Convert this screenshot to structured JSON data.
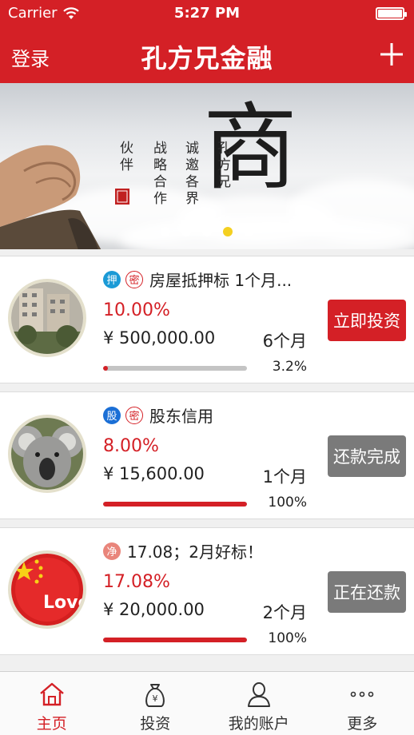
{
  "status_bar": {
    "carrier": "Carrier",
    "time": "5:27 PM"
  },
  "nav": {
    "login": "登录",
    "title": "孔方兄金融",
    "add_icon": "plus-icon"
  },
  "banner": {
    "big_char": "商",
    "col1": "孔方兄",
    "col2": "诚邀各界",
    "col3": "战略合作",
    "col4": "伙伴",
    "dot_count": 5,
    "active_dot": 3
  },
  "loans": [
    {
      "tags": [
        "押",
        "密"
      ],
      "title": "房屋抵押标 1个月...",
      "rate": "10.00%",
      "amount": "¥ 500,000.00",
      "term": "6个月",
      "progress": 0.032,
      "progress_text": "3.2%",
      "action": "立即投资",
      "action_style": "red",
      "avatar": "building-photo"
    },
    {
      "tags": [
        "股",
        "密"
      ],
      "title": "股东信用",
      "rate": "8.00%",
      "amount": "¥ 15,600.00",
      "term": "1个月",
      "progress": 1.0,
      "progress_text": "100%",
      "action": "还款完成",
      "action_style": "gray",
      "avatar": "koala-photo"
    },
    {
      "tags": [
        "净"
      ],
      "title": "17.08；2月好标！",
      "rate": "17.08%",
      "amount": "¥ 20,000.00",
      "term": "2个月",
      "progress": 1.0,
      "progress_text": "100%",
      "action": "正在还款",
      "action_style": "gray",
      "avatar": "china-flag-photo",
      "avatar_text": "Love Chi"
    }
  ],
  "tabs": [
    {
      "label": "主页",
      "icon": "home-icon",
      "active": true
    },
    {
      "label": "投资",
      "icon": "money-bag-icon",
      "active": false
    },
    {
      "label": "我的账户",
      "icon": "user-icon",
      "active": false
    },
    {
      "label": "更多",
      "icon": "more-icon",
      "active": false
    }
  ],
  "colors": {
    "brand": "#d42026",
    "dot_active": "#f4d021",
    "button_gray": "#7a7a7a"
  }
}
